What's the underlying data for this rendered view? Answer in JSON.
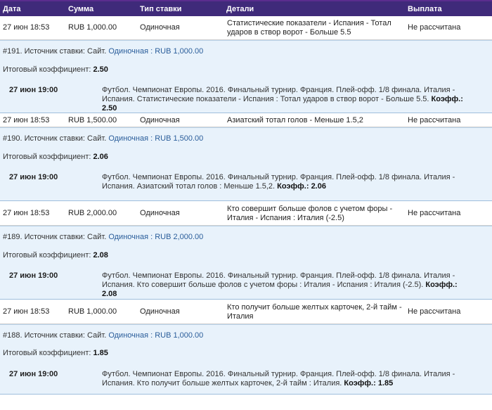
{
  "header": {
    "date": "Дата",
    "amount": "Сумма",
    "type": "Тип ставки",
    "details": "Детали",
    "payout": "Выплата"
  },
  "bets": [
    {
      "date": "27 июн 18:53",
      "amount": "RUB 1,000.00",
      "type": "Одиночная",
      "details": "Статистические показатели - Испания - Тотал ударов в створ ворот - Больше 5.5",
      "payout": "Не рассчитана",
      "source_prefix": "#191. Источник ставки: Сайт.",
      "source_link": "Одиночная : RUB 1,000.00",
      "coef_label": "Итоговый коэффициент:",
      "coef_value": "2.50",
      "event_time": "27 июн 19:00",
      "event_desc": "Футбол. Чемпионат Европы. 2016. Финальный турнир. Франция. Плей-офф. 1/8 финала. Италия - Испания. Статистические показатели - Испания : Тотал ударов в створ ворот - Больше 5.5.",
      "coeff_label": "Коэфф.:",
      "coeff_value": "2.50"
    },
    {
      "date": "27 июн 18:53",
      "amount": "RUB 1,500.00",
      "type": "Одиночная",
      "details": "Азиатский тотал голов - Меньше 1.5,2",
      "payout": "Не рассчитана",
      "source_prefix": "#190. Источник ставки: Сайт.",
      "source_link": "Одиночная : RUB 1,500.00",
      "coef_label": "Итоговый коэффициент:",
      "coef_value": "2.06",
      "event_time": "27 июн 19:00",
      "event_desc": "Футбол. Чемпионат Европы. 2016. Финальный турнир. Франция. Плей-офф. 1/8 финала. Италия - Испания. Азиатский тотал голов : Меньше 1.5,2.",
      "coeff_label": "Коэфф.:",
      "coeff_value": "2.06"
    },
    {
      "date": "27 июн 18:53",
      "amount": "RUB 2,000.00",
      "type": "Одиночная",
      "details": "Кто совершит больше фолов с учетом форы - Италия - Испания : Италия (-2.5)",
      "payout": "Не рассчитана",
      "source_prefix": "#189. Источник ставки: Сайт.",
      "source_link": "Одиночная : RUB 2,000.00",
      "coef_label": "Итоговый коэффициент:",
      "coef_value": "2.08",
      "event_time": "27 июн 19:00",
      "event_desc": "Футбол. Чемпионат Европы. 2016. Финальный турнир. Франция. Плей-офф. 1/8 финала. Италия - Испания. Кто совершит больше фолов с учетом форы : Италия - Испания : Италия (-2.5).",
      "coeff_label": "Коэфф.:",
      "coeff_value": "2.08"
    },
    {
      "date": "27 июн 18:53",
      "amount": "RUB 1,000.00",
      "type": "Одиночная",
      "details": "Кто получит больше желтых карточек, 2-й тайм - Италия",
      "payout": "Не рассчитана",
      "source_prefix": "#188. Источник ставки: Сайт.",
      "source_link": "Одиночная : RUB 1,000.00",
      "coef_label": "Итоговый коэффициент:",
      "coef_value": "1.85",
      "event_time": "27 июн 19:00",
      "event_desc": "Футбол. Чемпионат Европы. 2016. Финальный турнир. Франция. Плей-офф. 1/8 финала. Италия - Испания. Кто получит больше желтых карточек, 2-й тайм : Италия.",
      "coeff_label": "Коэфф.:",
      "coeff_value": "1.85"
    }
  ]
}
